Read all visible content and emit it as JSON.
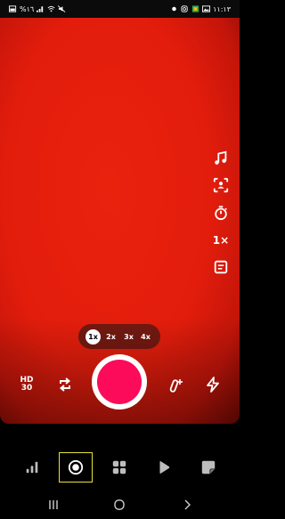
{
  "status_bar": {
    "left_text": "%١٦",
    "time": "١١:١٣"
  },
  "side_controls": {
    "speed_label": "1×"
  },
  "zoom": {
    "options": [
      "1x",
      "2x",
      "3x",
      "4x"
    ],
    "selected": "1x"
  },
  "camera_controls": {
    "quality_line1": "HD",
    "quality_line2": "30"
  },
  "icons": {
    "music": "music-note-icon",
    "face": "face-detect-icon",
    "timer": "timer-icon",
    "caption": "caption-icon",
    "flip": "flip-camera-icon",
    "beauty": "magic-wand-icon",
    "flash": "flash-icon"
  },
  "bottom_nav": {
    "items": [
      "stats-icon",
      "record-icon",
      "grid-icon",
      "play-icon",
      "sticker-icon"
    ],
    "selected_index": 1,
    "highlight_color": "#e9e13a"
  },
  "colors": {
    "record": "#fb0b5a",
    "viewfinder": "#e31d0c"
  }
}
